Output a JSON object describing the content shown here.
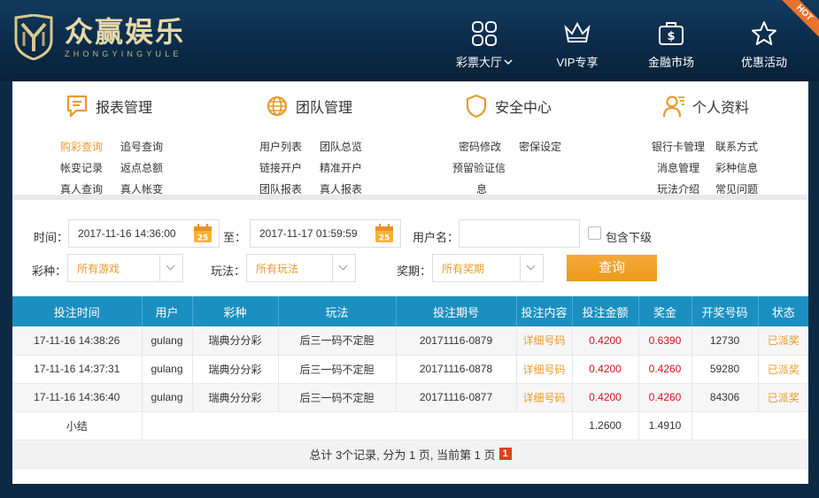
{
  "brand": {
    "name": "众赢娱乐",
    "pinyin": "ZHONGYINGYULE"
  },
  "nav": [
    {
      "label": "彩票大厅",
      "icon": "grid-icon",
      "has_dropdown": true
    },
    {
      "label": "VIP专享",
      "icon": "crown-icon"
    },
    {
      "label": "金融市场",
      "icon": "briefcase-dollar-icon"
    },
    {
      "label": "优惠活动",
      "icon": "star-icon"
    }
  ],
  "hot_badge": "HOT",
  "menu": {
    "reports": {
      "title": "报表管理",
      "items": [
        "购彩查询",
        "追号查询",
        "帐变记录",
        "返点总额",
        "真人查询",
        "真人帐变"
      ]
    },
    "team": {
      "title": "团队管理",
      "items": [
        "用户列表",
        "团队总览",
        "链接开户",
        "精准开户",
        "团队报表",
        "真人报表"
      ]
    },
    "security": {
      "title": "安全中心",
      "items": [
        "密码修改",
        "密保设定",
        "预留验证信",
        "息"
      ]
    },
    "profile": {
      "title": "个人资料",
      "items": [
        "银行卡管理",
        "联系方式",
        "消息管理",
        "彩种信息",
        "玩法介绍",
        "常见问题"
      ]
    }
  },
  "filters": {
    "time_label": "时间：",
    "start_time": "2017-11-16 14:36:00",
    "to_label": "至：",
    "end_time": "2017-11-17 01:59:59",
    "username_label": "用户名：",
    "username_value": "",
    "include_sub_label": "包含下级",
    "include_sub_checked": false,
    "lottery_label": "彩种：",
    "lottery_value": "所有游戏",
    "play_label": "玩法：",
    "play_value": "所有玩法",
    "prize_label": "奖期：",
    "prize_value": "所有奖期",
    "query_button": "查询",
    "calendar_day": "25"
  },
  "table": {
    "headers": [
      "投注时间",
      "用户",
      "彩种",
      "玩法",
      "投注期号",
      "投注内容",
      "投注金额",
      "奖金",
      "开奖号码",
      "状态"
    ],
    "rows": [
      [
        "17-11-16 14:38:26",
        "gulang",
        "瑞典分分彩",
        "后三一码不定胆",
        "20171116-0879",
        "详细号码",
        "0.4200",
        "0.6390",
        "12730",
        "已派奖"
      ],
      [
        "17-11-16 14:37:31",
        "gulang",
        "瑞典分分彩",
        "后三一码不定胆",
        "20171116-0878",
        "详细号码",
        "0.4200",
        "0.4260",
        "59280",
        "已派奖"
      ],
      [
        "17-11-16 14:36:40",
        "gulang",
        "瑞典分分彩",
        "后三一码不定胆",
        "20171116-0877",
        "详细号码",
        "0.4200",
        "0.4260",
        "84306",
        "已派奖"
      ]
    ],
    "subtotal_label": "小结",
    "subtotal_amount": "1.2600",
    "subtotal_bonus": "1.4910",
    "pager_text": "总计 3个记录, 分为 1 页, 当前第 1 页",
    "current_page": "1"
  },
  "colors": {
    "accent": "#1b8fc0",
    "orange": "#e99a2d",
    "red": "#d0141d",
    "header_bg": "#0b2a47"
  }
}
